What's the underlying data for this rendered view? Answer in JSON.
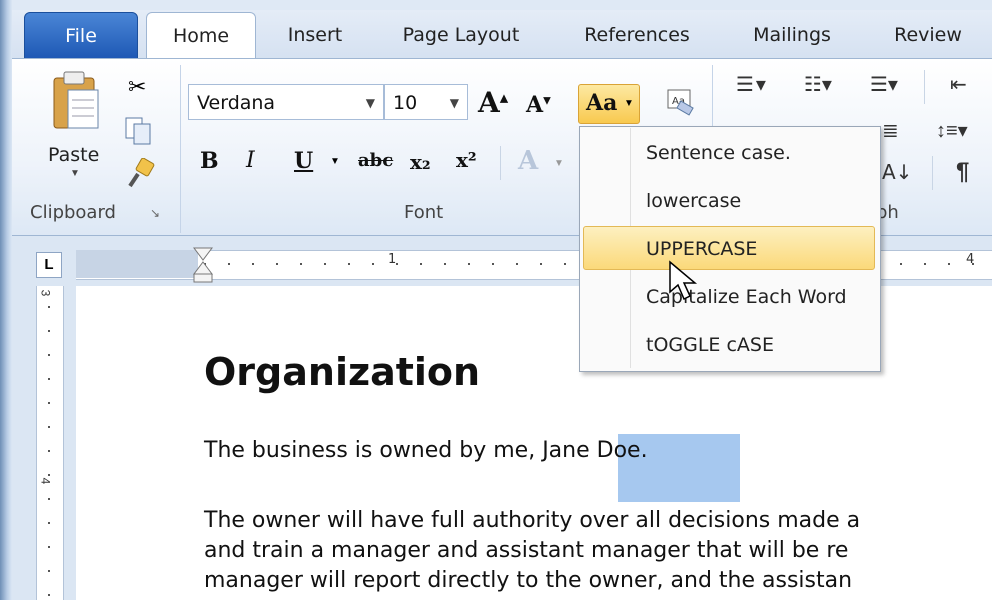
{
  "tabs": [
    "File",
    "Home",
    "Insert",
    "Page Layout",
    "References",
    "Mailings",
    "Review"
  ],
  "clipboard": {
    "paste_label": "Paste",
    "group_label": "Clipboard"
  },
  "font": {
    "name": "Verdana",
    "size": "10",
    "group_label": "Font",
    "grow": "A",
    "shrink": "A",
    "change_case": "Aa",
    "bold": "B",
    "italic": "I",
    "underline": "U",
    "strike": "abc",
    "subscript": "x₂",
    "superscript": "x²",
    "text_effects": "A"
  },
  "paragraph": {
    "group_label": "ph",
    "sort": "A↓",
    "pilcrow": "¶"
  },
  "ruler": {
    "marks": [
      "1",
      "4"
    ],
    "vertical_marks": [
      "3",
      "4"
    ]
  },
  "change_case_menu": {
    "items": [
      "Sentence case.",
      "lowercase",
      "UPPERCASE",
      "Capitalize Each Word",
      "tOGGLE cASE"
    ],
    "highlighted": "UPPERCASE"
  },
  "document": {
    "heading": "Organization",
    "p1_before": "The business is owned by me, ",
    "p1_selected": "Jane Doe",
    "p1_after": ".",
    "p2_line1": "The owner will have full authority over all decisions made a",
    "p2_line2": "and train a manager and assistant manager that will be re",
    "p2_line3": "manager will report directly to the owner, and the assistan"
  }
}
